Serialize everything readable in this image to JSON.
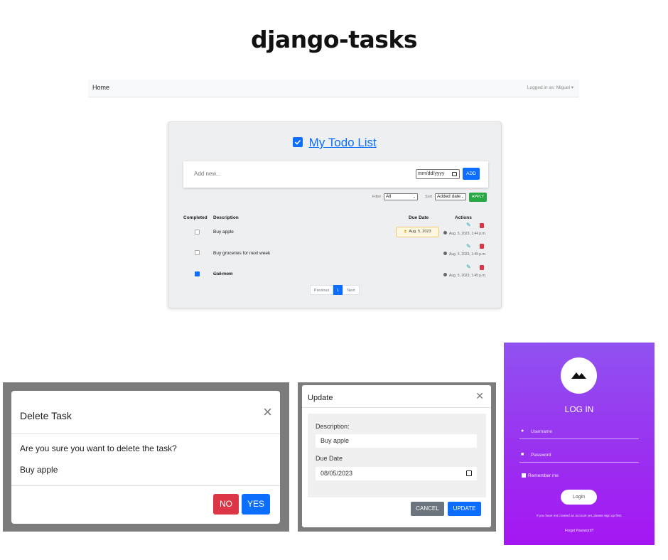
{
  "page_title": "django-tasks",
  "navbar": {
    "home": "Home",
    "user": "Logged in as: Miguel"
  },
  "todo": {
    "title": "My Todo List",
    "add_placeholder": "Add new...",
    "date_placeholder": "mm/dd/yyyy",
    "add_button": "ADD",
    "filter_label": "Filter",
    "filter_value": "All",
    "sort_label": "Sort",
    "sort_value": "Added date",
    "apply_button": "APPLY",
    "columns": {
      "completed": "Completed",
      "description": "Description",
      "due": "Due Date",
      "actions": "Actions"
    },
    "tasks": [
      {
        "description": "Buy apple",
        "completed": false,
        "due": "Aug. 5, 2023",
        "added": "Aug. 5, 2023, 1:44 p.m."
      },
      {
        "description": "Buy groceries for next week",
        "completed": false,
        "due": "",
        "added": "Aug. 5, 2023, 1:45 p.m."
      },
      {
        "description": "Call mom",
        "completed": true,
        "due": "",
        "added": "Aug. 5, 2023, 1:45 p.m."
      }
    ],
    "pagination": {
      "previous": "Previous",
      "page": "1",
      "next": "Next"
    }
  },
  "delete_modal": {
    "title": "Delete Task",
    "question": "Are you sure you want to delete the task?",
    "task": "Buy apple",
    "no": "NO",
    "yes": "YES"
  },
  "update_modal": {
    "title": "Update",
    "description_label": "Description:",
    "description_value": "Buy apple",
    "due_label": "Due Date",
    "due_value": "08/05/2023",
    "cancel": "CANCEL",
    "update": "UPDATE"
  },
  "login": {
    "title": "LOG IN",
    "username_placeholder": "Username",
    "password_placeholder": "Password",
    "remember": "Remember me",
    "button": "Login",
    "signup_note": "If you have not created an account yet, please sign up first.",
    "forgot": "Forget Password?"
  },
  "colors": {
    "primary": "#0d6efd",
    "danger": "#dc3545",
    "success": "#28a745",
    "login_gradient": "#9a30f0"
  }
}
